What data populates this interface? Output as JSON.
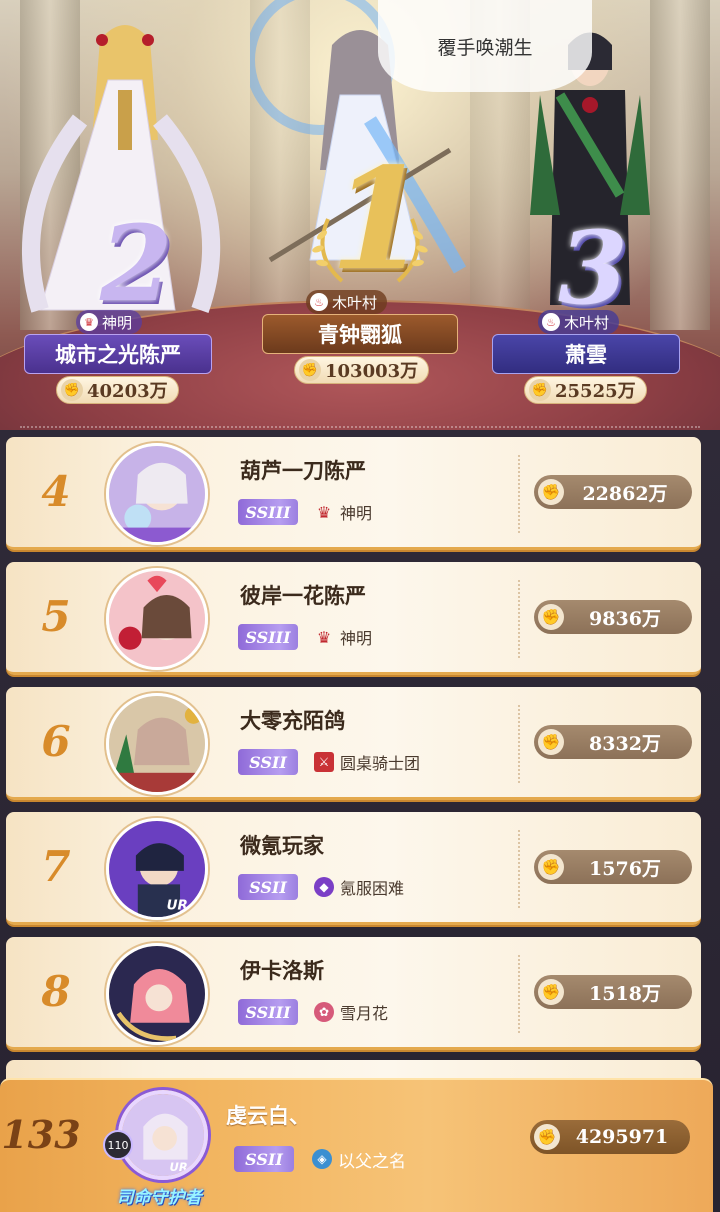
{
  "speech_bubble": "覆手唤潮生",
  "podium": [
    {
      "rank": "2",
      "guild": "神明",
      "name": "城市之光陈严",
      "power": "40203万",
      "accent": "#5a3f9e"
    },
    {
      "rank": "1",
      "guild": "木叶村",
      "name": "青钟翾狐",
      "power": "103003万",
      "accent": "#8a4f2a"
    },
    {
      "rank": "3",
      "guild": "木叶村",
      "name": "萧雲",
      "power": "25525万",
      "accent": "#3e3a8e"
    }
  ],
  "rows": [
    {
      "rank": "4",
      "name": "葫芦一刀陈严",
      "tier": "SSIII",
      "guild": "神明",
      "guild_icon": "crown-icon",
      "power": "22862万"
    },
    {
      "rank": "5",
      "name": "彼岸一花陈严",
      "tier": "SSIII",
      "guild": "神明",
      "guild_icon": "crown-icon",
      "power": "9836万"
    },
    {
      "rank": "6",
      "name": "大零充陌鸽",
      "tier": "SSII",
      "guild": "圆桌骑士团",
      "guild_icon": "swords-shield-icon",
      "power": "8332万"
    },
    {
      "rank": "7",
      "name": "微氪玩家",
      "tier": "SSII",
      "guild": "氪服困难",
      "guild_icon": "diamond-icon",
      "power": "1576万"
    },
    {
      "rank": "8",
      "name": "伊卡洛斯",
      "tier": "SSIII",
      "guild": "雪月花",
      "guild_icon": "flower-icon",
      "power": "1518万"
    }
  ],
  "mine": {
    "rank": "133",
    "level": "110",
    "name": "虔云白、",
    "tier": "SSII",
    "guild": "以父之名",
    "power": "4295971",
    "badge": "司命守护者"
  },
  "colors": {
    "rank_orange": "#d88b2a",
    "power_pill": "#8c7158",
    "tier_purple": "#9b7fe0",
    "self_row": "#f2b560"
  }
}
